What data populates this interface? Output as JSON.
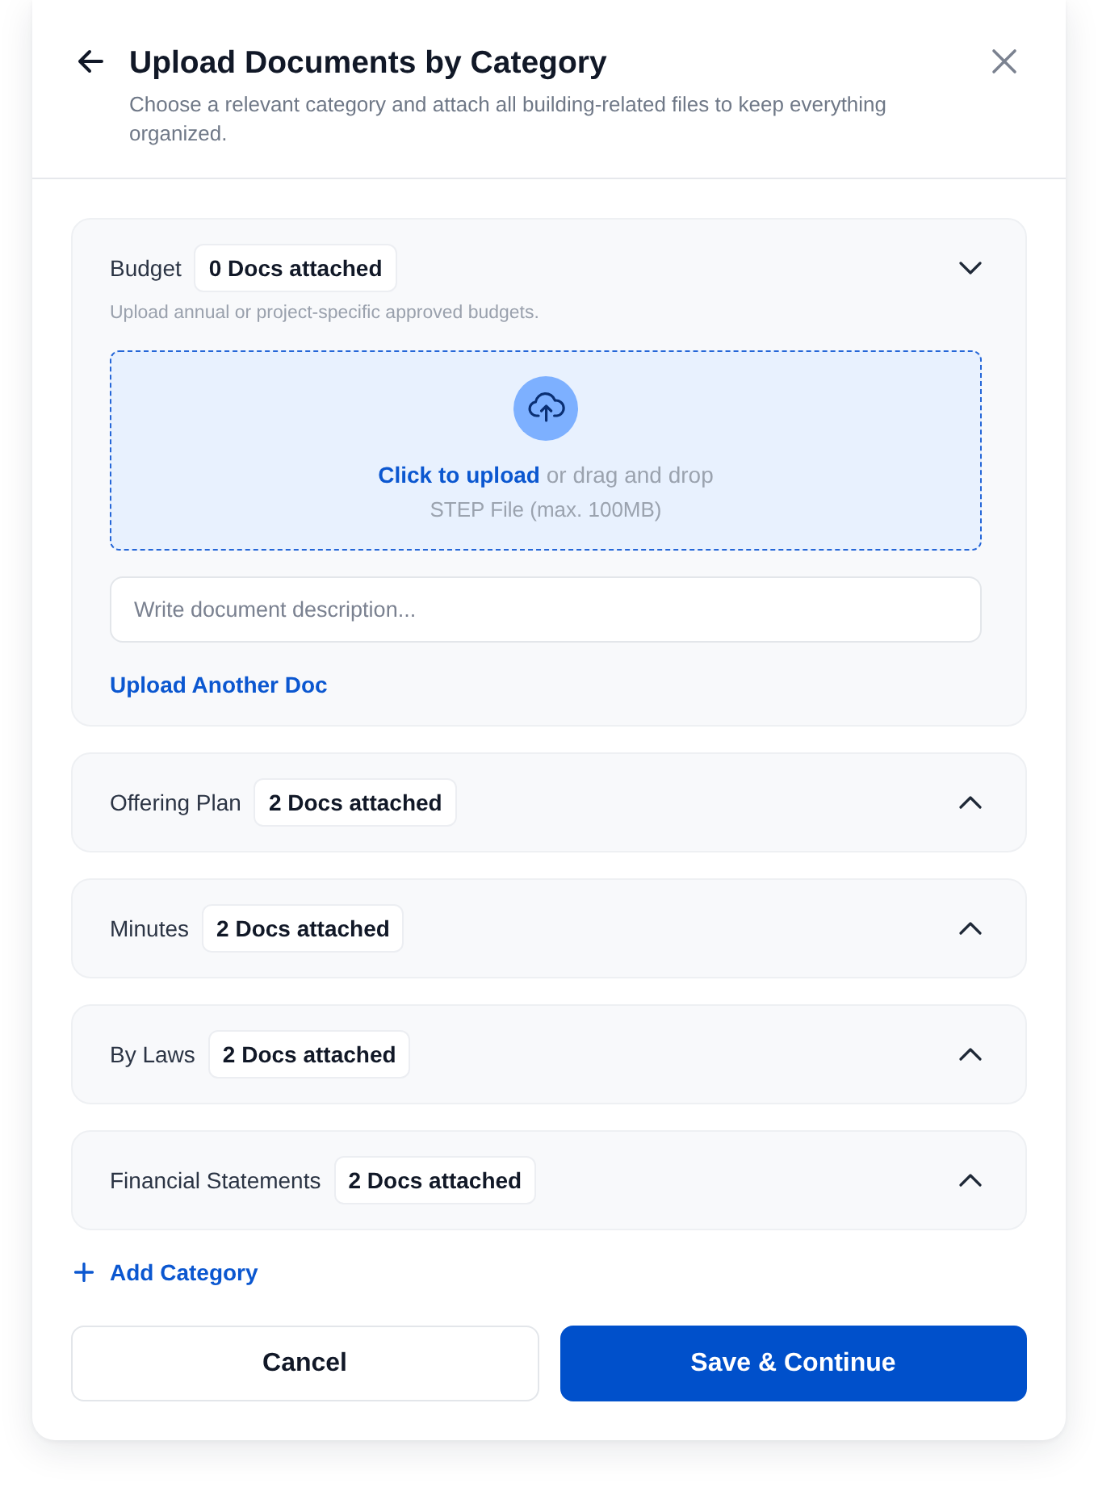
{
  "header": {
    "title": "Upload Documents by Category",
    "subtitle": "Choose a relevant category and attach all building-related files to keep everything organized."
  },
  "categories": [
    {
      "name": "Budget",
      "badge": "0 Docs attached",
      "expanded": true,
      "hint": "Upload annual or project-specific approved budgets.",
      "upload": {
        "link": "Click to upload",
        "text": "or drag and drop",
        "note": "STEP File (max. 100MB)"
      },
      "description": {
        "placeholder": "Write document description..."
      },
      "another_link": "Upload Another Doc"
    },
    {
      "name": "Offering Plan",
      "badge": "2 Docs attached",
      "expanded": false
    },
    {
      "name": "Minutes",
      "badge": "2 Docs attached",
      "expanded": false
    },
    {
      "name": "By Laws",
      "badge": "2 Docs attached",
      "expanded": false
    },
    {
      "name": "Financial Statements",
      "badge": "2 Docs attached",
      "expanded": false
    }
  ],
  "add_category": "Add Category",
  "buttons": [
    {
      "label": "Cancel",
      "kind": "secondary"
    },
    {
      "label": "Save & Continue",
      "kind": "primary"
    }
  ]
}
